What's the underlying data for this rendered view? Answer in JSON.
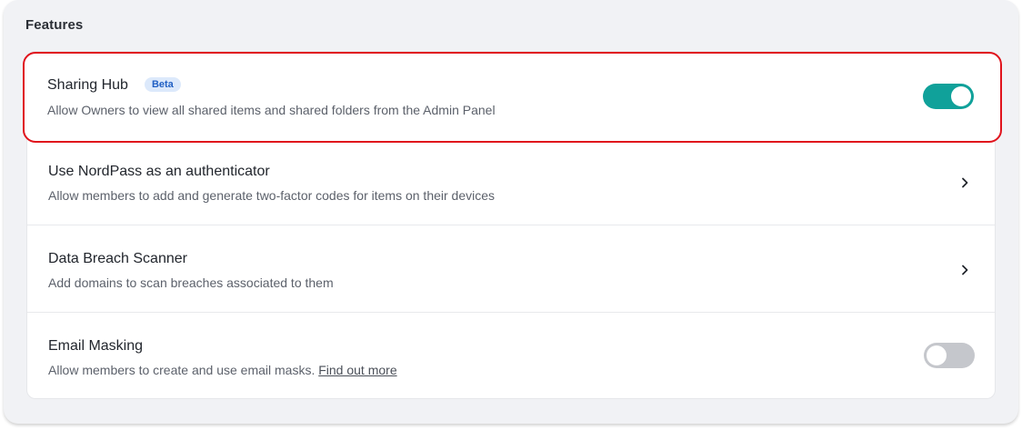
{
  "section": {
    "title": "Features"
  },
  "features": [
    {
      "title": "Sharing Hub",
      "badge": "Beta",
      "description": "Allow Owners to view all shared items and shared folders from the Admin Panel",
      "control": "toggle",
      "enabled": true
    },
    {
      "title": "Use NordPass as an authenticator",
      "description": "Allow members to add and generate two-factor codes for items on their devices",
      "control": "chevron",
      "icon": "chevron-right-icon"
    },
    {
      "title": "Data Breach Scanner",
      "description": "Add domains to scan breaches associated to them",
      "control": "chevron",
      "icon": "chevron-right-icon"
    },
    {
      "title": "Email Masking",
      "description": "Allow members to create and use email masks.",
      "link_text": "Find out more",
      "control": "toggle",
      "enabled": false
    }
  ],
  "colors": {
    "toggle_on": "#10a19a",
    "toggle_off": "#c5c7cc",
    "highlight_border": "#e0131c",
    "badge_bg": "#dce9fb",
    "badge_text": "#2160c4"
  }
}
